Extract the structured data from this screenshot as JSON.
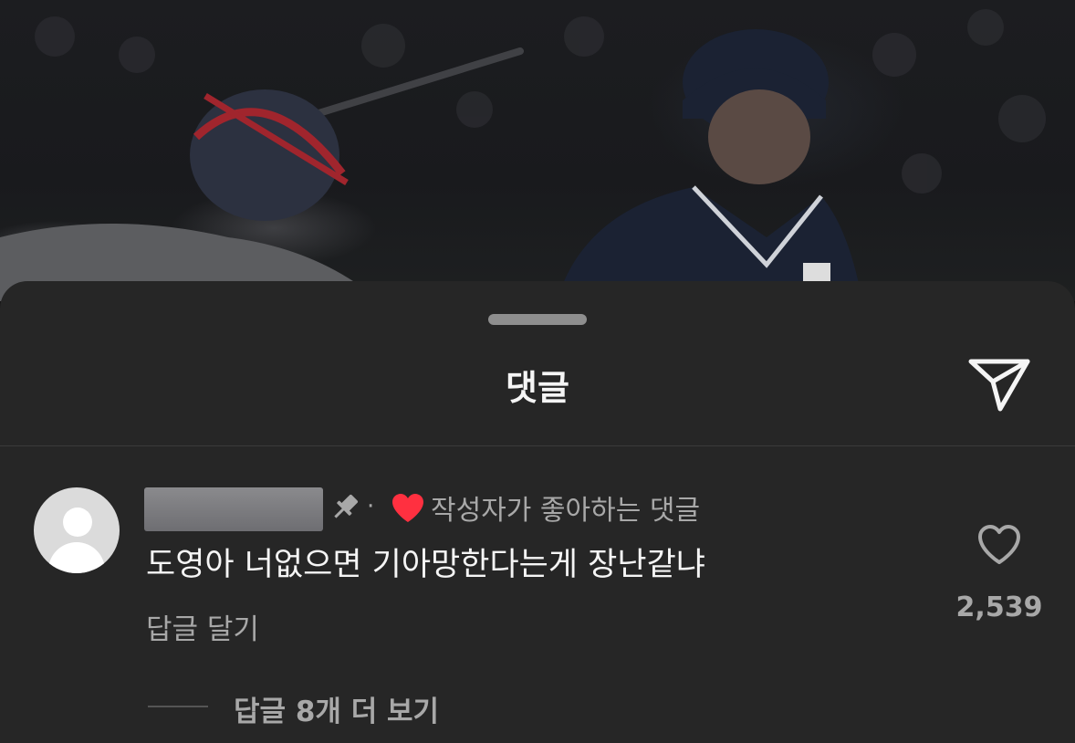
{
  "sheet": {
    "title": "댓글",
    "icons": {
      "grabber": "drag-handle",
      "send": "paper-plane-icon"
    }
  },
  "comment": {
    "pin_icon": "pin-icon",
    "separator": "·",
    "liked_heart_color": "#ff3040",
    "liked_by_author_label": "작성자가 좋아하는 댓글",
    "text": "도영아 너없으면 기아망한다는게 장난같냐",
    "reply_label": "답글 달기",
    "like_icon": "heart-outline-icon",
    "like_count": "2,539",
    "view_replies_label": "답글 8개 더 보기"
  },
  "colors": {
    "sheet_bg": "#262626",
    "primary_text": "#f5f5f5",
    "secondary_text": "#a8a8a8",
    "accent_red": "#ff3040"
  }
}
